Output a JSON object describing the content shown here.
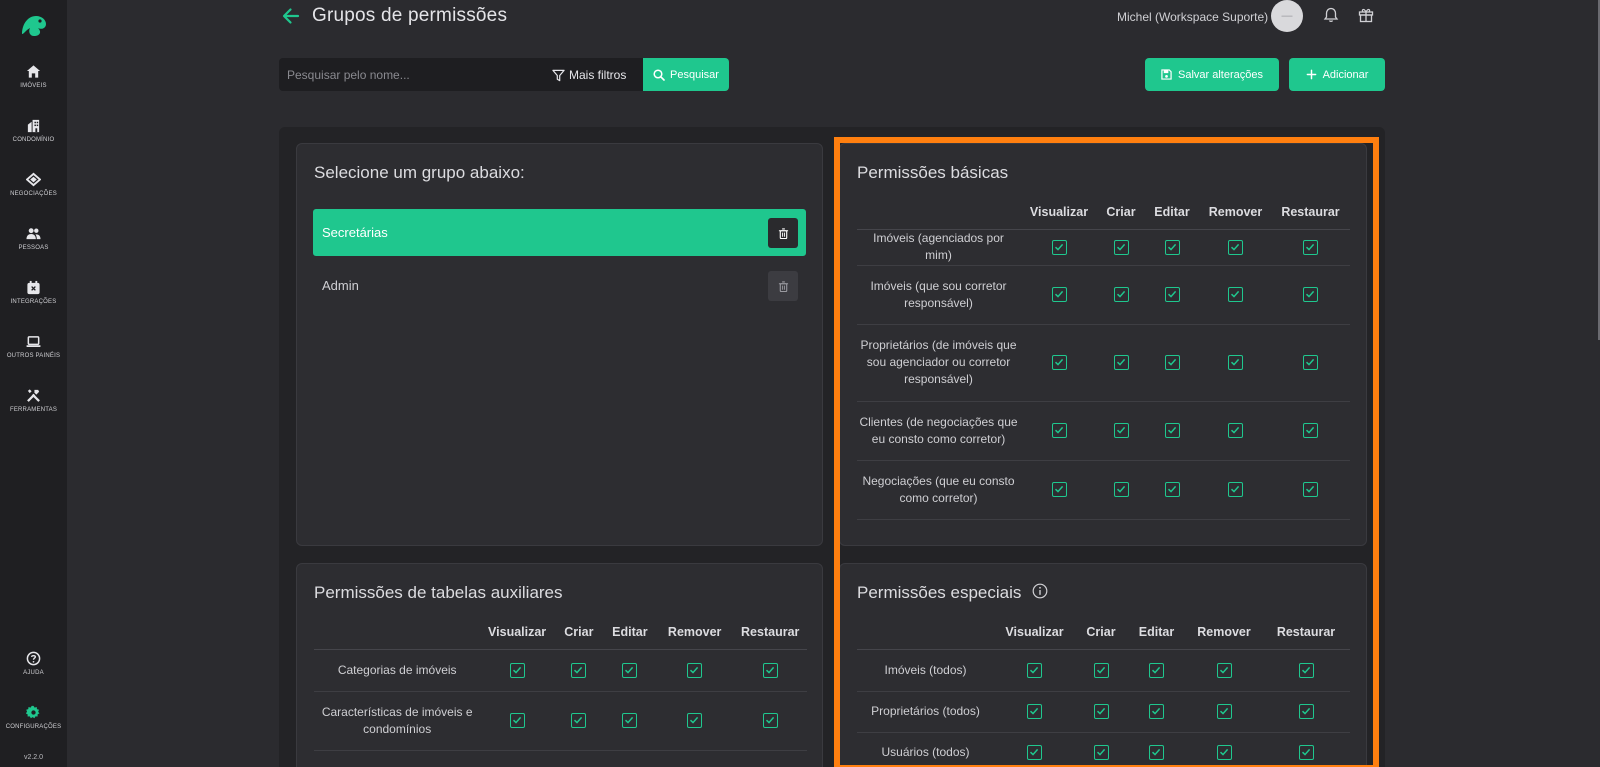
{
  "sidebar": {
    "items": [
      {
        "label": "IMÓVEIS",
        "icon": "home-icon"
      },
      {
        "label": "CONDOMÍNIO",
        "icon": "building-icon"
      },
      {
        "label": "NEGOCIAÇÕES",
        "icon": "handshake-icon"
      },
      {
        "label": "PESSOAS",
        "icon": "people-icon"
      },
      {
        "label": "INTEGRAÇÕES",
        "icon": "integrations-icon"
      },
      {
        "label": "OUTROS PAINÉIS",
        "icon": "laptop-icon"
      },
      {
        "label": "FERRAMENTAS",
        "icon": "tools-icon"
      }
    ],
    "help_label": "AJUDA",
    "settings_label": "CONFIGURAÇÕES",
    "version": "v2.2.0"
  },
  "header": {
    "title": "Grupos de permissões",
    "user_name": "Michel (Workspace Suporte)",
    "avatar_text": "—"
  },
  "search": {
    "placeholder": "Pesquisar pelo nome...",
    "filters_label": "Mais filtros",
    "search_label": "Pesquisar"
  },
  "actions": {
    "save_label": "Salvar alterações",
    "add_label": "Adicionar"
  },
  "groups": {
    "title": "Selecione um grupo abaixo:",
    "items": [
      "Secretárias",
      "Admin"
    ],
    "selected": "Secretárias"
  },
  "columns": [
    "Visualizar",
    "Criar",
    "Editar",
    "Remover",
    "Restaurar"
  ],
  "basic": {
    "title": "Permissões básicas",
    "rows": [
      {
        "label": "Imóveis (agenciados por mim)",
        "checked": [
          true,
          true,
          true,
          true,
          true
        ]
      },
      {
        "label": "Imóveis (que sou corretor responsável)",
        "checked": [
          true,
          true,
          true,
          true,
          true
        ]
      },
      {
        "label": "Proprietários (de imóveis que sou agenciador ou corretor responsável)",
        "checked": [
          true,
          true,
          true,
          true,
          true
        ]
      },
      {
        "label": "Clientes (de negociações que eu consto como corretor)",
        "checked": [
          true,
          true,
          true,
          true,
          true
        ]
      },
      {
        "label": "Negociações (que eu consto como corretor)",
        "checked": [
          true,
          true,
          true,
          true,
          true
        ]
      }
    ]
  },
  "aux": {
    "title": "Permissões de tabelas auxiliares",
    "rows": [
      {
        "label": "Categorias de imóveis",
        "checked": [
          true,
          true,
          true,
          true,
          true
        ]
      },
      {
        "label": "Características de imóveis e condomínios",
        "checked": [
          true,
          true,
          true,
          true,
          true
        ]
      }
    ]
  },
  "special": {
    "title": "Permissões especiais",
    "rows": [
      {
        "label": "Imóveis (todos)",
        "checked": [
          true,
          true,
          true,
          true,
          true
        ]
      },
      {
        "label": "Proprietários (todos)",
        "checked": [
          true,
          true,
          true,
          true,
          true
        ]
      },
      {
        "label": "Usuários (todos)",
        "checked": [
          true,
          true,
          true,
          true,
          true
        ]
      }
    ]
  },
  "colors": {
    "accent": "#1fc78e",
    "highlight": "#ff7f0f",
    "background": "#2b2b2f",
    "sidebar": "#1f1f22"
  }
}
